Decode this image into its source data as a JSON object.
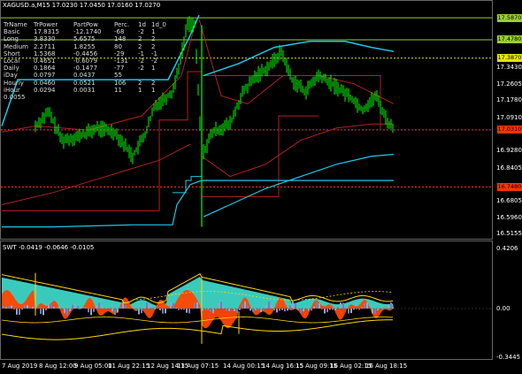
{
  "symbol_header": "XAGUSD.a,M15  17.0230 17.0450 17.0160 17.0270",
  "table": {
    "headers": [
      "TrName",
      "TrPower",
      "PartPow",
      "Perc.",
      "1d",
      "1d_0"
    ],
    "rows": [
      [
        "Basic",
        "17.8315",
        "-12.1740",
        "-68",
        "-2",
        "1"
      ],
      [
        "Long",
        "3.8330",
        "5.6575",
        "148",
        "2",
        "2"
      ],
      [
        "Medium",
        "2.2711",
        "1.8255",
        "80",
        "2",
        "2"
      ],
      [
        "Short",
        "1.5368",
        "-0.4456",
        "-29",
        "-1",
        "-1"
      ],
      [
        "Local",
        "0.4651",
        "-0.6079",
        "-131",
        "-2",
        "-2"
      ],
      [
        "Daily",
        "0.1864",
        "-0.1477",
        "-77",
        "-2",
        "1"
      ],
      [
        "iDay",
        "0.0797",
        "0.0437",
        "55",
        "",
        ""
      ],
      [
        "Hourly",
        "0.0460",
        "0.0521",
        "106",
        "2",
        "2"
      ],
      [
        "iHour",
        "0.0294",
        "0.0031",
        "11",
        "1",
        "1"
      ]
    ],
    "footer": "0.0055"
  },
  "price_axis": [
    "17.5870",
    "17.4780",
    "17.3870",
    "17.3430",
    "17.2605",
    "17.1780",
    "17.0910",
    "17.0310",
    "16.9280",
    "16.8405",
    "16.7480",
    "16.6805",
    "16.5960",
    "16.5155"
  ],
  "price_tags": [
    {
      "value": "17.5870",
      "color": "#9acd32"
    },
    {
      "value": "17.4780",
      "color": "#9acd32"
    },
    {
      "value": "17.3870",
      "color": "#e6e600"
    },
    {
      "value": "17.0310",
      "color": "#ff3300"
    },
    {
      "value": "16.7480",
      "color": "#ff3300"
    }
  ],
  "indicator_header": "SWT  -0.0419  -0.0646  -0.0105",
  "indicator_axis": [
    "0.4206",
    "0.00",
    "-0.3445"
  ],
  "time_axis": [
    "7 Aug 2019",
    "8 Aug 12:00",
    "9 Aug 05:00",
    "11 Aug 22:15",
    "12 Aug 14:15",
    "13 Aug 07:15",
    "14 Aug 00:15",
    "14 Aug 16:15",
    "15 Aug 09:15",
    "16 Aug 02:15",
    "16 Aug 18:15"
  ],
  "colors": {
    "background": "#000000",
    "candles": "#00ff00",
    "bands": "#1ec8e6",
    "trend": "#b22222",
    "levels": "#9acd32",
    "osc_cyan": "#40e0d0",
    "osc_orange": "#ff4500",
    "osc_yellow": "#ffd700"
  }
}
